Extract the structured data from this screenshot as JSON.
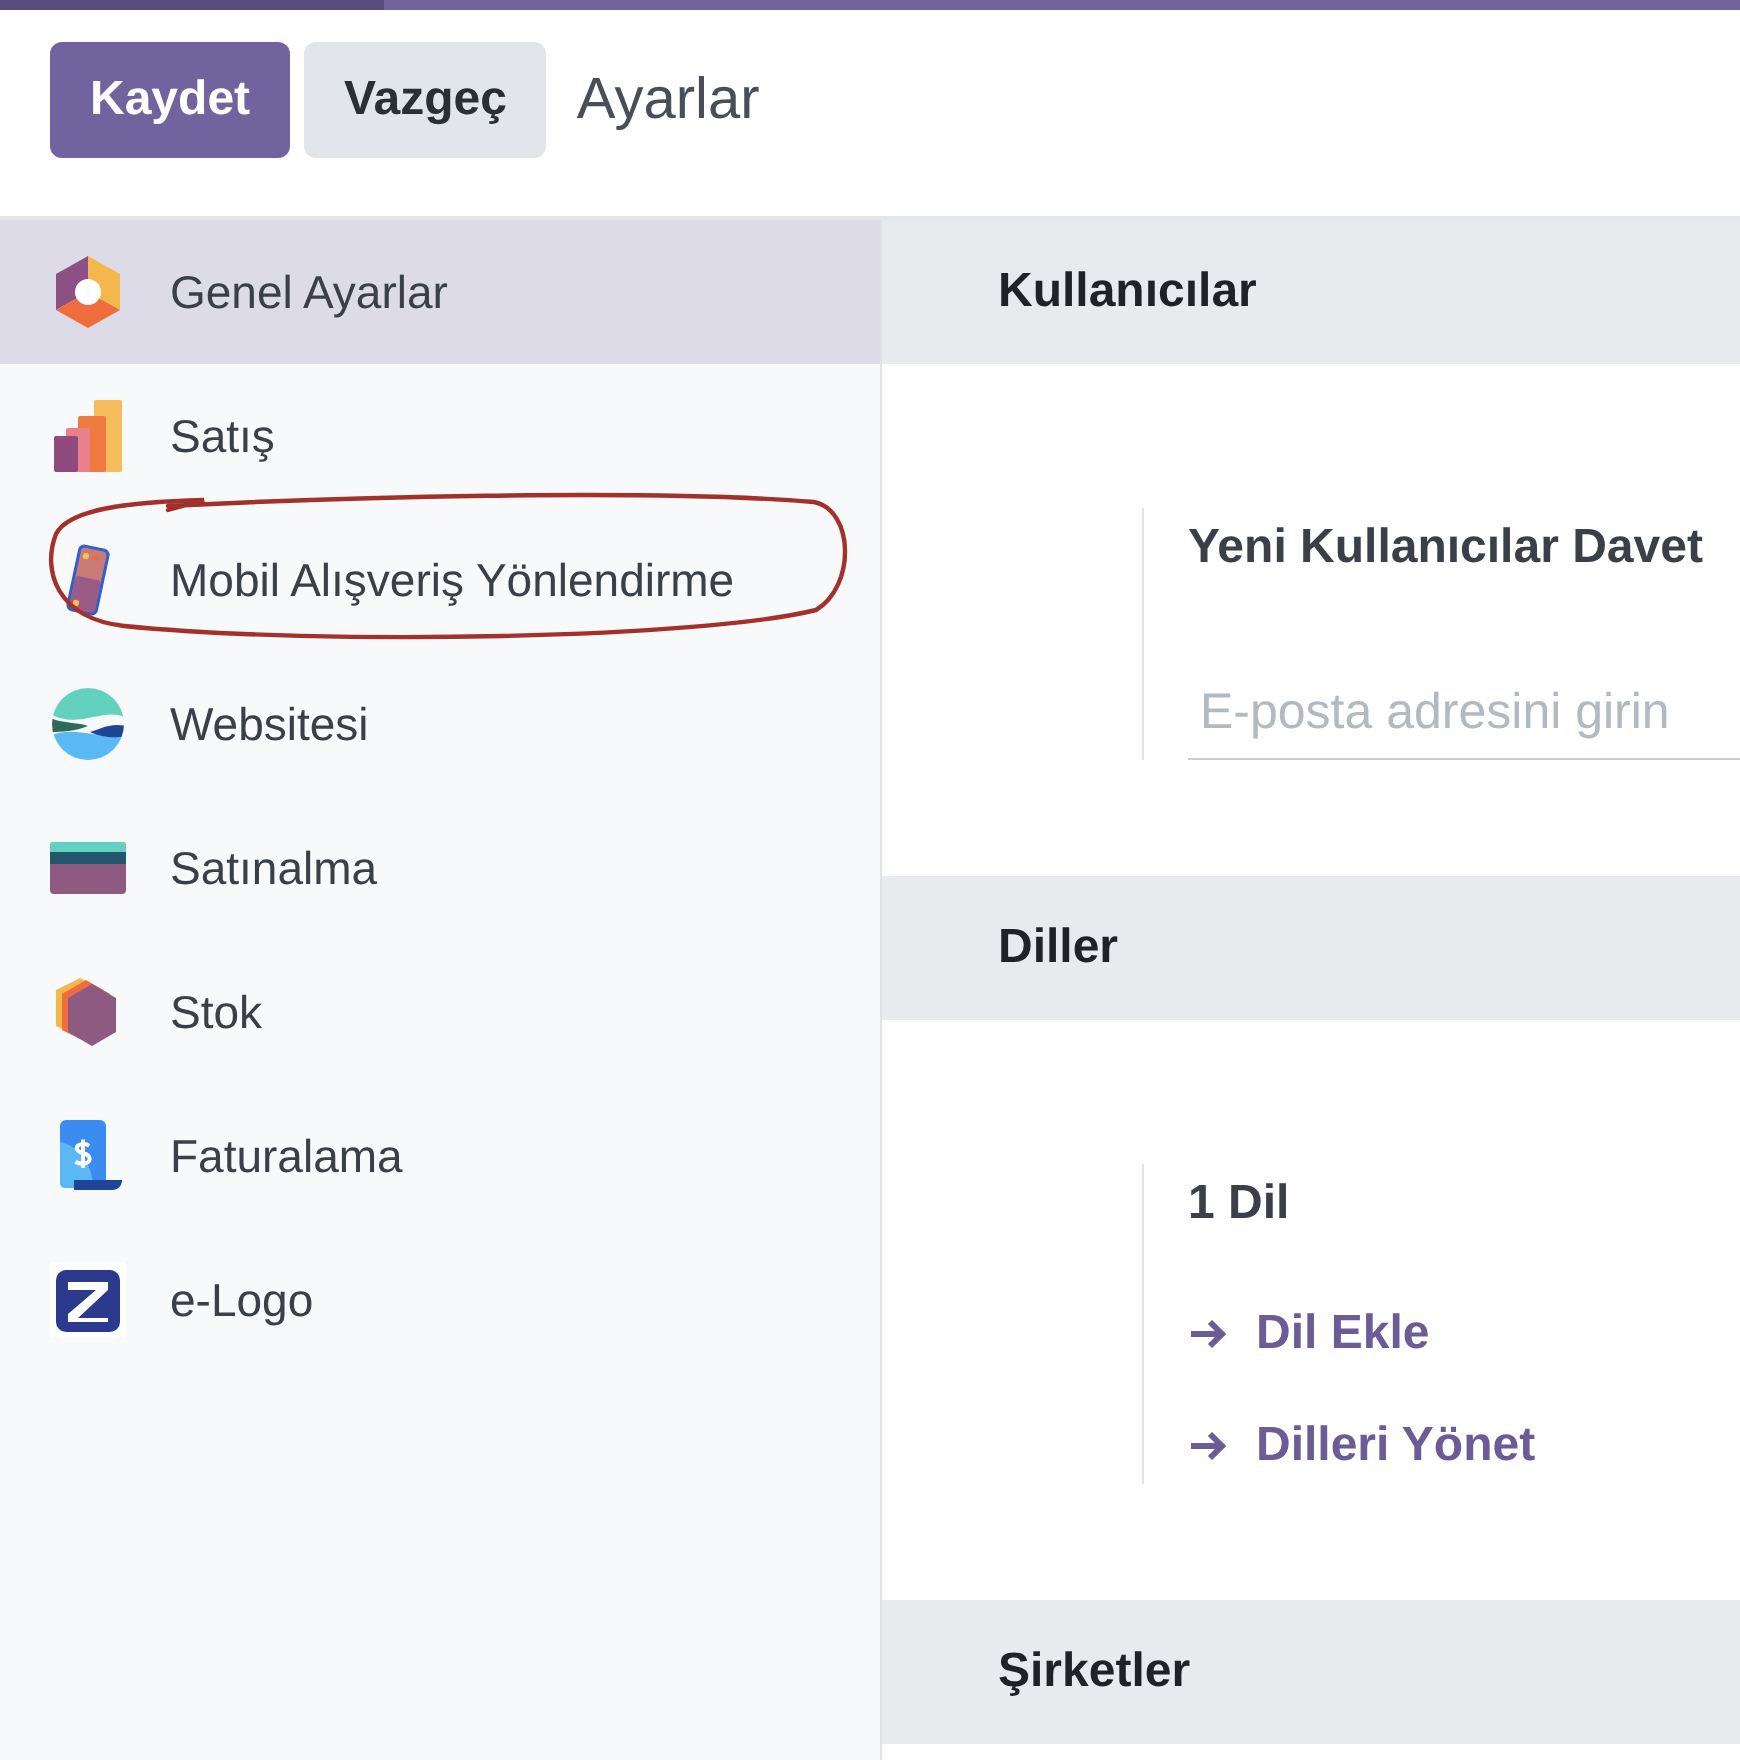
{
  "header": {
    "buttons": [
      {
        "label": "Kaydet",
        "kind": "primary"
      },
      {
        "label": "Vazgeç",
        "kind": "secondary"
      }
    ],
    "title": "Ayarlar"
  },
  "sidebar": {
    "items": [
      {
        "label": "Genel Ayarlar",
        "selected": true,
        "circled": false
      },
      {
        "label": "Satış",
        "selected": false,
        "circled": false
      },
      {
        "label": "Mobil Alışveriş Yönlendirme",
        "selected": false,
        "circled": true
      },
      {
        "label": "Websitesi",
        "selected": false,
        "circled": false
      },
      {
        "label": "Satınalma",
        "selected": false,
        "circled": false
      },
      {
        "label": "Stok",
        "selected": false,
        "circled": false
      },
      {
        "label": "Faturalama",
        "selected": false,
        "circled": false
      },
      {
        "label": "e-Logo",
        "selected": false,
        "circled": false
      }
    ]
  },
  "sections": [
    {
      "title": "Kullanıcılar",
      "setting": {
        "label": "Yeni Kullanıcılar Davet",
        "field": {
          "placeholder": "E-posta adresini girin"
        }
      }
    },
    {
      "title": "Diller",
      "setting": {
        "label": "1 Dil",
        "links": [
          "Dil Ekle",
          "Dilleri Yönet"
        ]
      }
    },
    {
      "title": "Şirketler"
    }
  ]
}
